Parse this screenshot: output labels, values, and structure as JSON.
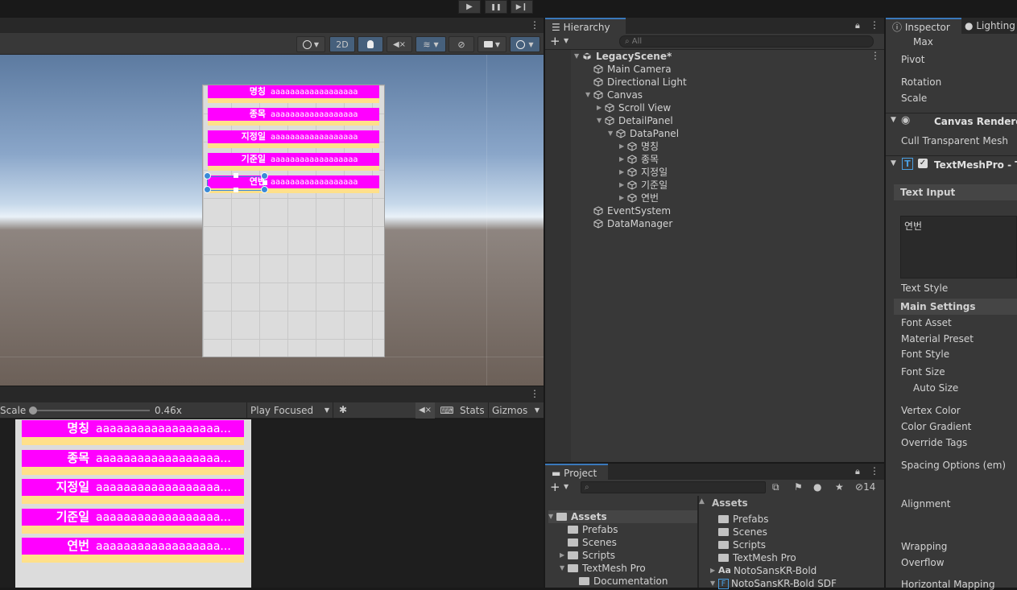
{
  "toolbar": {
    "play": "▶",
    "pause": "❚❚",
    "step": "▶❙"
  },
  "scene": {
    "btn_2d": "2D",
    "rows": [
      {
        "label": "명칭",
        "value": "aaaaaaaaaaaaaaaaaa"
      },
      {
        "label": "종목",
        "value": "aaaaaaaaaaaaaaaaaa"
      },
      {
        "label": "지정일",
        "value": "aaaaaaaaaaaaaaaaaa"
      },
      {
        "label": "기준일",
        "value": "aaaaaaaaaaaaaaaaaa"
      },
      {
        "label": "연번",
        "value": "aaaaaaaaaaaaaaaaaa"
      }
    ]
  },
  "game": {
    "scale_label": "Scale",
    "scale_value": "0.46x",
    "scale_fraction": 0.0,
    "play_mode": "Play Focused",
    "stats": "Stats",
    "gizmos": "Gizmos",
    "rows": [
      {
        "label": "명칭",
        "value": "aaaaaaaaaaaaaaaaaa..."
      },
      {
        "label": "종목",
        "value": "aaaaaaaaaaaaaaaaaa..."
      },
      {
        "label": "지정일",
        "value": "aaaaaaaaaaaaaaaaaa..."
      },
      {
        "label": "기준일",
        "value": "aaaaaaaaaaaaaaaaaa..."
      },
      {
        "label": "연번",
        "value": "aaaaaaaaaaaaaaaaaa..."
      }
    ]
  },
  "hierarchy": {
    "tab": "Hierarchy",
    "search_placeholder": "All",
    "items": [
      {
        "label": "LegacyScene*"
      },
      {
        "label": "Main Camera"
      },
      {
        "label": "Directional Light"
      },
      {
        "label": "Canvas"
      },
      {
        "label": "Scroll View"
      },
      {
        "label": "DetailPanel"
      },
      {
        "label": "DataPanel"
      },
      {
        "label": "명칭"
      },
      {
        "label": "종목"
      },
      {
        "label": "지정일"
      },
      {
        "label": "기준일"
      },
      {
        "label": "연번"
      },
      {
        "label": "EventSystem"
      },
      {
        "label": "DataManager"
      }
    ]
  },
  "project": {
    "tab": "Project",
    "hidden_count": "14",
    "left": [
      {
        "label": "Assets"
      },
      {
        "label": "Prefabs"
      },
      {
        "label": "Scenes"
      },
      {
        "label": "Scripts"
      },
      {
        "label": "TextMesh Pro"
      },
      {
        "label": "Documentation"
      }
    ],
    "right_header": "Assets",
    "right": [
      {
        "label": "Prefabs"
      },
      {
        "label": "Scenes"
      },
      {
        "label": "Scripts"
      },
      {
        "label": "TextMesh Pro"
      },
      {
        "label": "NotoSansKR-Bold"
      },
      {
        "label": "NotoSansKR-Bold SDF"
      }
    ],
    "font_glyph": "Aa",
    "sdf_glyph": "F"
  },
  "inspector": {
    "tab_inspector": "Inspector",
    "tab_lighting": "Lighting",
    "max": "Max",
    "pivot": "Pivot",
    "rotation": "Rotation",
    "scale": "Scale",
    "canvas_renderer": "Canvas Renderer",
    "cull": "Cull Transparent Mesh",
    "tmp": "TextMeshPro - Te",
    "text_input": "Text Input",
    "text_value": "연번",
    "text_style": "Text Style",
    "main_settings": "Main Settings",
    "font_asset": "Font Asset",
    "material_preset": "Material Preset",
    "font_style": "Font Style",
    "font_size": "Font Size",
    "auto_size": "Auto Size",
    "vertex_color": "Vertex Color",
    "color_gradient": "Color Gradient",
    "override_tags": "Override Tags",
    "spacing": "Spacing Options (em)",
    "alignment": "Alignment",
    "wrapping": "Wrapping",
    "overflow": "Overflow",
    "horizontal_mapping": "Horizontal Mapping",
    "tmp_glyph": "T"
  }
}
